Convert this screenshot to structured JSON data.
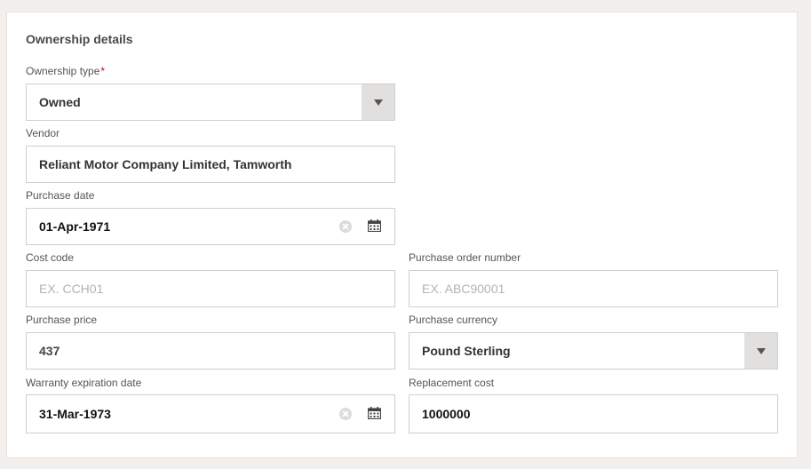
{
  "section": {
    "title": "Ownership details"
  },
  "ownership_type": {
    "label": "Ownership type",
    "required_mark": "*",
    "value": "Owned"
  },
  "vendor": {
    "label": "Vendor",
    "value": "Reliant Motor Company Limited, Tamworth"
  },
  "purchase_date": {
    "label": "Purchase date",
    "value": "01-Apr-1971"
  },
  "cost_code": {
    "label": "Cost code",
    "placeholder": "EX. CCH01"
  },
  "purchase_order_number": {
    "label": "Purchase order number",
    "placeholder": "EX. ABC90001"
  },
  "purchase_price": {
    "label": "Purchase price",
    "value": "437"
  },
  "purchase_currency": {
    "label": "Purchase currency",
    "value": "Pound Sterling"
  },
  "warranty_expiration_date": {
    "label": "Warranty expiration date",
    "value": "31-Mar-1973"
  },
  "replacement_cost": {
    "label": "Replacement cost",
    "value": "1000000"
  },
  "icons": {
    "dropdown": "chevron-down-icon",
    "clear": "clear-icon",
    "calendar": "calendar-icon"
  },
  "colors": {
    "required": "#d0021b",
    "dropdown_button": "#e2e0de",
    "border": "#cfcfcf"
  }
}
